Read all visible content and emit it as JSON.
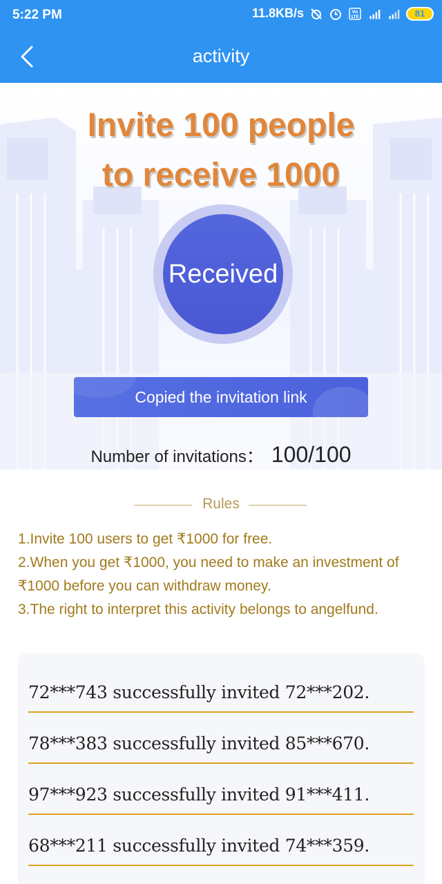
{
  "status_bar": {
    "time": "5:22 PM",
    "net_speed": "11.8KB/s",
    "battery": "81"
  },
  "header": {
    "title": "activity"
  },
  "hero": {
    "headline_line1": "Invite 100 people",
    "headline_line2": "to receive 1000",
    "status_button": "Received",
    "copy_button": "Copied the invitation link",
    "invitations_label": "Number of invitations：",
    "invitations_value": "100/100"
  },
  "rules": {
    "title": "Rules",
    "items": [
      "1.Invite 100 users to get ₹1000 for free.",
      "2.When you get ₹1000, you need to make an investment of ₹1000 before you can withdraw money.",
      "3.The right to interpret this activity belongs to angelfund."
    ]
  },
  "invites": [
    "72***743 successfully invited 72***202.",
    "78***383 successfully invited 85***670.",
    "97***923 successfully invited 91***411.",
    "68***211 successfully invited 74***359."
  ],
  "colors": {
    "primary": "#2f93f2",
    "headline": "#e1863a",
    "button": "#4b61dc",
    "rules_text": "#a17a1c",
    "underline": "#d9a21e"
  }
}
